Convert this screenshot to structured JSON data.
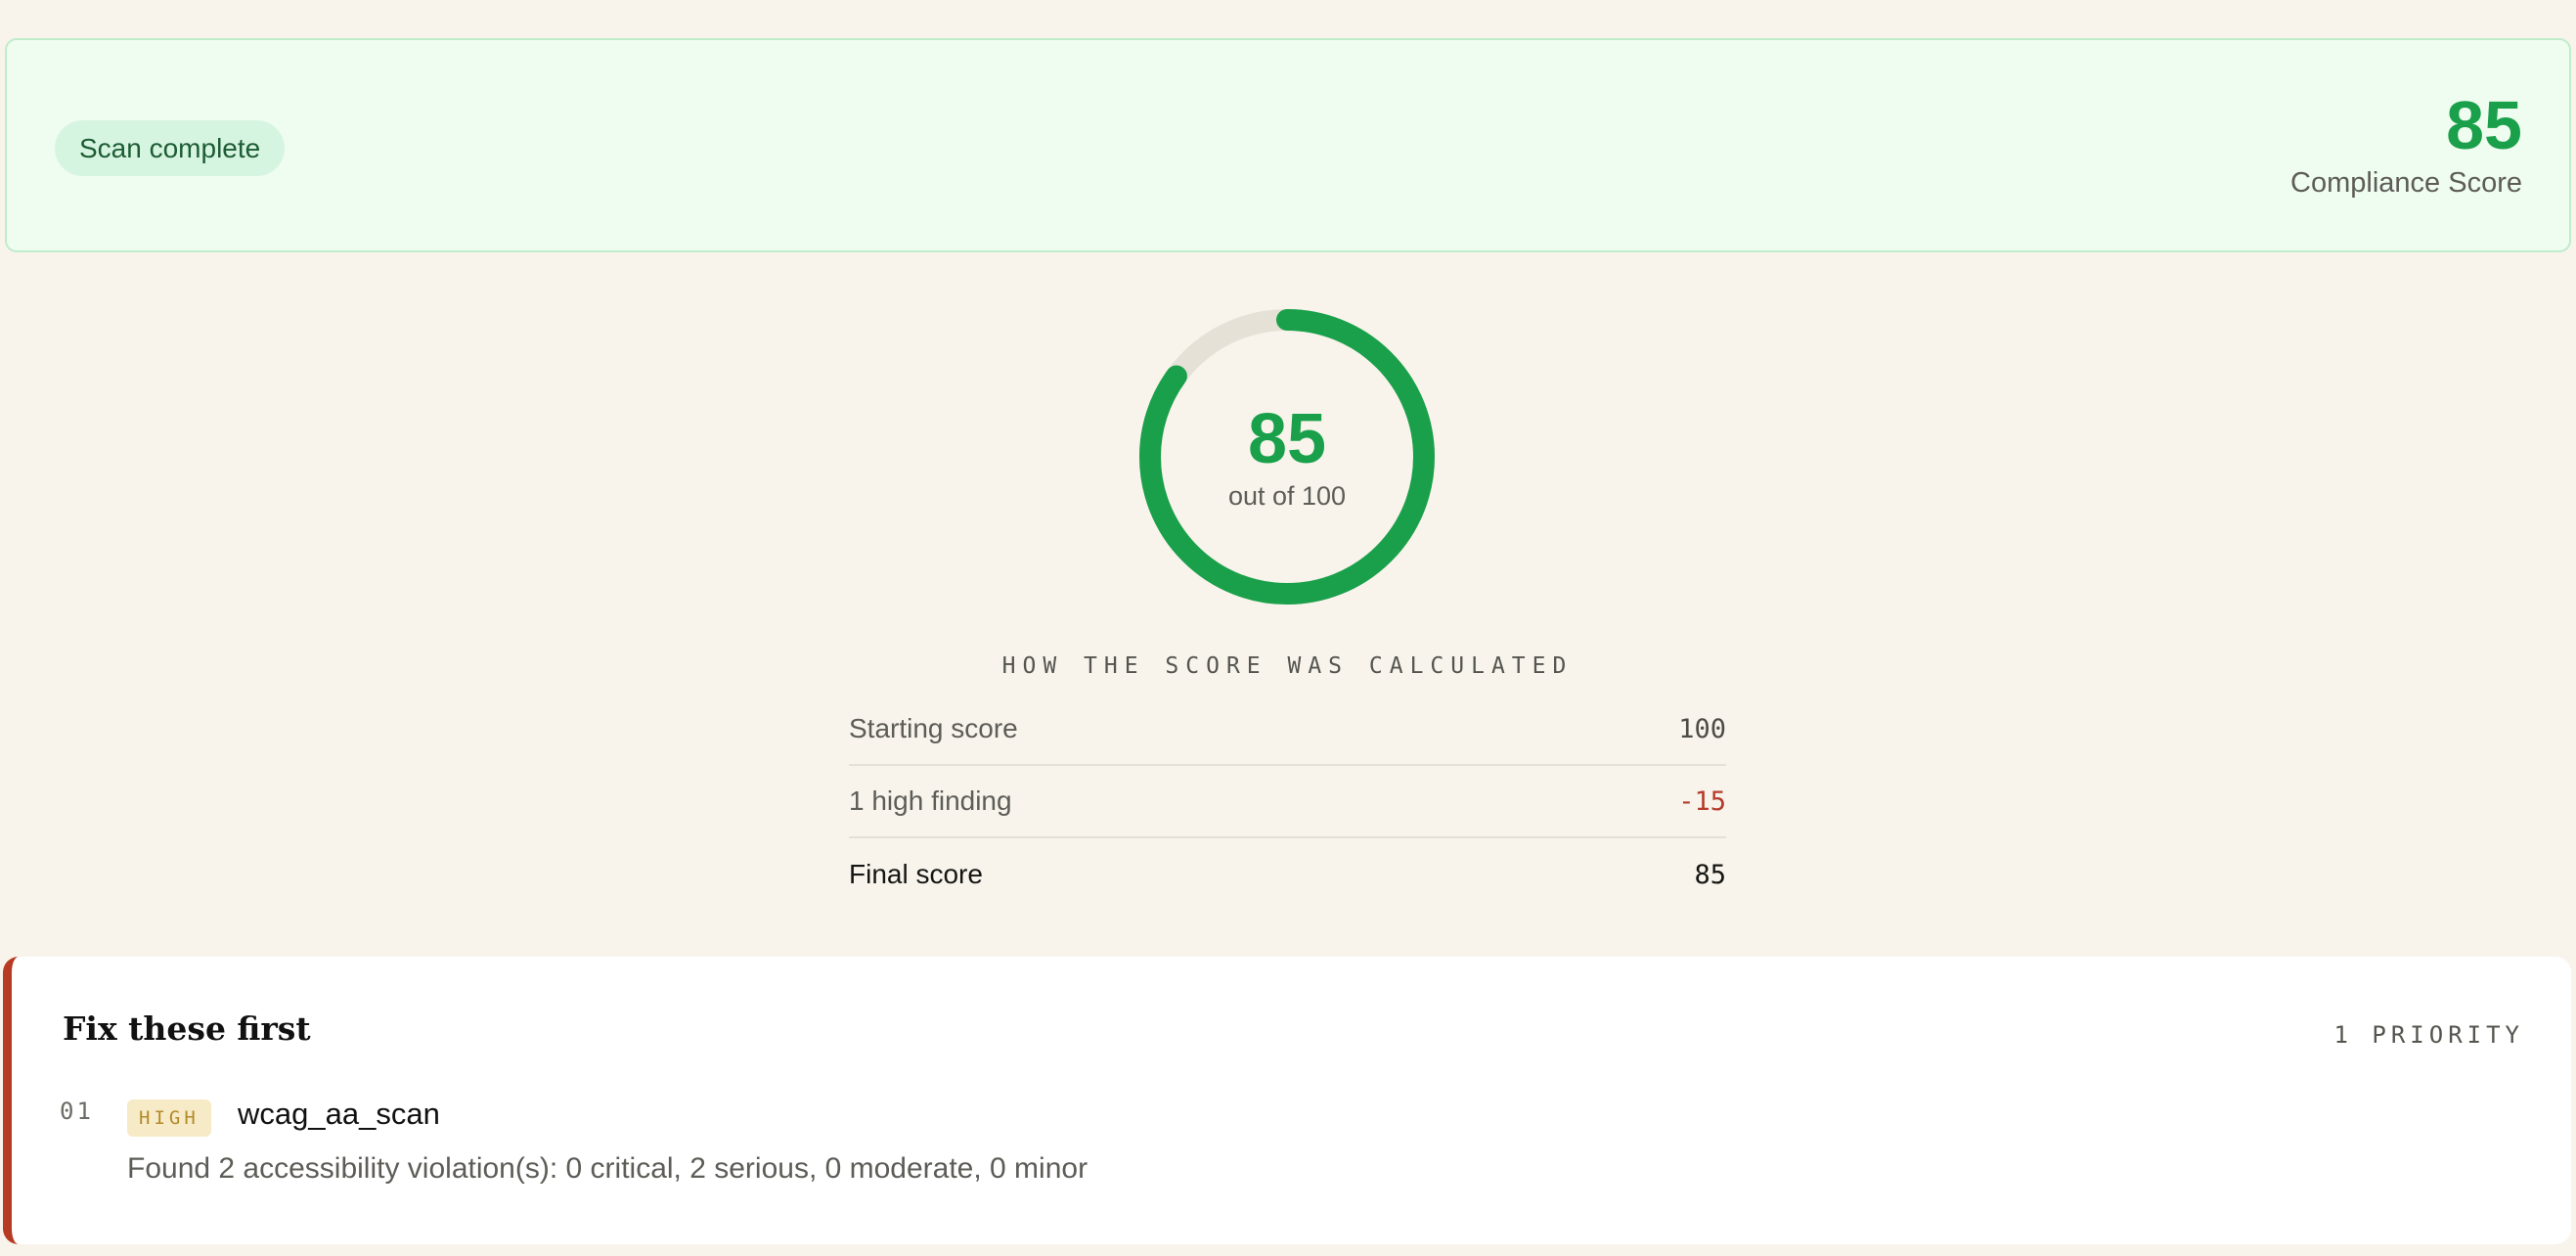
{
  "banner": {
    "status": "Scan complete",
    "score": "85",
    "score_label": "Compliance Score"
  },
  "gauge": {
    "value": "85",
    "caption": "out of 100",
    "fraction": 0.85,
    "color": "#1aa04a",
    "track_color": "#e6e1d6"
  },
  "calculation": {
    "title": "HOW THE SCORE WAS CALCULATED",
    "rows": [
      {
        "label": "Starting score",
        "value": "100"
      },
      {
        "label": "1 high finding",
        "value": "-15"
      },
      {
        "label": "Final score",
        "value": "85"
      }
    ]
  },
  "priorities": {
    "title": "Fix these first",
    "count": "1 PRIORITY",
    "items": [
      {
        "number": "01",
        "severity": "HIGH",
        "name": "wcag_aa_scan",
        "description": "Found 2 accessibility violation(s): 0 critical, 2 serious, 0 moderate, 0 minor"
      }
    ]
  }
}
